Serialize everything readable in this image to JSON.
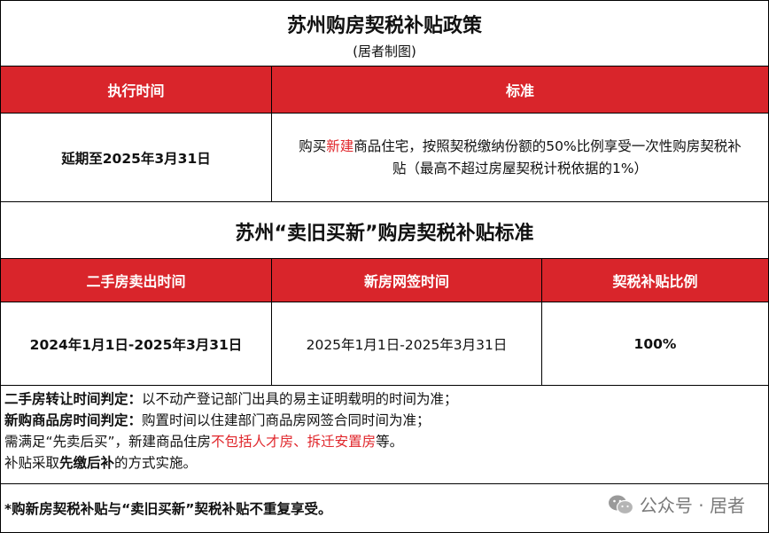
{
  "policy": {
    "title": "苏州购房契税补贴政策",
    "subtitle": "(居者制图)",
    "headers": [
      "执行时间",
      "标准"
    ],
    "time": "延期至2025年3月31日",
    "standard": {
      "part1": "购买",
      "highlight": "新建",
      "part2": "商品住宅，按照契税缴纳份额的50%比例享受一次性购房契税补",
      "line2": "贴（最高不超过房屋契税计税依据的1%）"
    }
  },
  "replace": {
    "title": "苏州“卖旧买新”购房契税补贴标准",
    "headers": [
      "二手房卖出时间",
      "新房网签时间",
      "契税补贴比例"
    ],
    "values": [
      "2024年1月1日-2025年3月31日",
      "2025年1月1日-2025年3月31日",
      "100%"
    ]
  },
  "notes": {
    "n1_label": "二手房转让时间判定：",
    "n1_text": "以不动产登记部门出具的易主证明载明的时间为准；",
    "n2_label": "新购商品房时间判定：",
    "n2_text": "购置时间以住建部门商品房网签合同时间为准；",
    "n3_a": "需满足“先卖后买”，新建商品住房",
    "n3_highlight": "不包括人才房、拆迁安置房",
    "n3_b": "等。",
    "n4_a": "补贴采取",
    "n4_bold": "先缴后补",
    "n4_b": "的方式实施。"
  },
  "footer": "*购新房契税补贴与“卖旧买新”契税补贴不重复享受。",
  "watermark": "公众号 · 居者",
  "colors": {
    "header_red": "#d9252b",
    "highlight_red": "#e0262b"
  }
}
